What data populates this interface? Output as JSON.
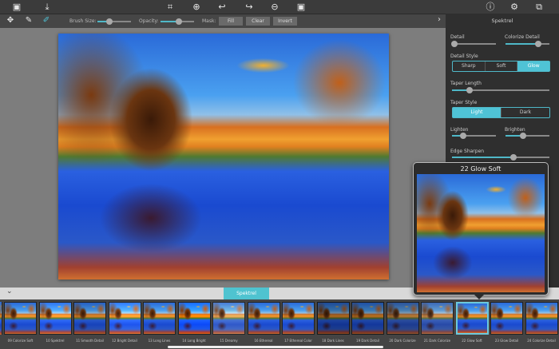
{
  "top_toolbar": {
    "icons": [
      "open-image-icon",
      "save-icon",
      "crop-icon",
      "zoom-in-icon",
      "undo-icon",
      "redo-icon",
      "zoom-out-icon",
      "fit-screen-icon",
      "info-icon",
      "settings-icon",
      "share-icon"
    ]
  },
  "tool_options": {
    "tools": [
      "move-tool-icon",
      "brush-tool-icon",
      "eraser-tool-icon"
    ],
    "brush_size_label": "Brush Size:",
    "brush_size": 0.35,
    "opacity_label": "Opacity:",
    "opacity": 0.55,
    "mask_label": "Mask:",
    "fill": "Fill",
    "clear": "Clear",
    "invert": "Invert",
    "collapse_arrow": "›"
  },
  "panel": {
    "title": "Spektrel",
    "detail": {
      "label": "Detail",
      "value": 0.05
    },
    "colorize_detail": {
      "label": "Colorize Detail",
      "value": 0.75
    },
    "detail_style": {
      "label": "Detail Style",
      "options": [
        "Sharp",
        "Soft",
        "Glow"
      ],
      "selected": "Glow"
    },
    "taper_length": {
      "label": "Taper Length",
      "value": 0.18
    },
    "taper_style": {
      "label": "Taper Style",
      "options": [
        "Light",
        "Dark"
      ],
      "selected": "Light"
    },
    "lighten": {
      "label": "Lighten",
      "value": 0.25
    },
    "brighten": {
      "label": "Brighten",
      "value": 0.4
    },
    "edge_sharpen": {
      "label": "Edge Sharpen",
      "value": 0.63
    }
  },
  "bottom": {
    "toggle": "⌄",
    "category_tab": "Spektrel"
  },
  "presets": [
    "09 Colorize Soft",
    "10 Spektrel",
    "11 Smooth Detail",
    "12 Bright Detail",
    "13 Long Lines",
    "14 Long Bright",
    "15 Dreamy",
    "16 Ethereal",
    "17 Ethereal Color",
    "18 Dark Lines",
    "19 Dark Detail",
    "20 Dark Colorize",
    "21 Dark Colorize",
    "22 Glow Soft",
    "23 Glow Detail",
    "24 Colorize Detail"
  ],
  "selected_preset": "22 Glow Soft",
  "preview": {
    "title": "22 Glow Soft"
  },
  "colors": {
    "accent": "#4fc3d6",
    "toolbar": "#3b3b3b",
    "panel": "#2f2f2f"
  }
}
